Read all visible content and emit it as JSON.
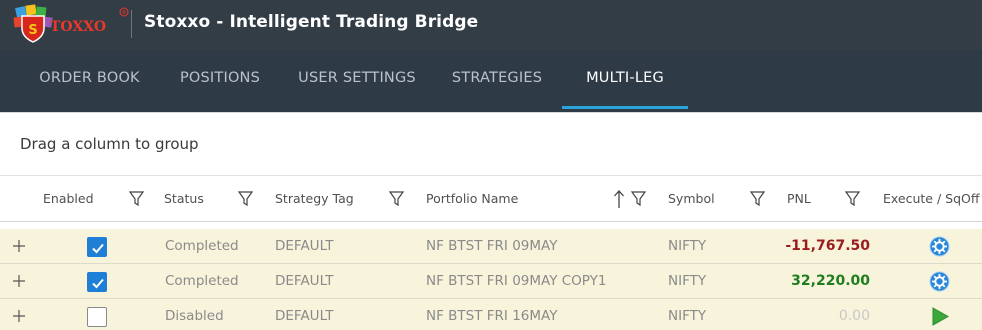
{
  "app": {
    "logo_text": "TOXXO",
    "title": "Stoxxo - Intelligent Trading Bridge"
  },
  "nav": {
    "tabs": [
      {
        "label": "ORDER BOOK",
        "active": false
      },
      {
        "label": "POSITIONS",
        "active": false
      },
      {
        "label": "USER SETTINGS",
        "active": false
      },
      {
        "label": "STRATEGIES",
        "active": false
      },
      {
        "label": "MULTI-LEG",
        "active": true
      }
    ],
    "accent": "#29a3d9"
  },
  "grid": {
    "group_panel_text": "Drag a column to group",
    "columns": {
      "enabled": "Enabled",
      "status": "Status",
      "strategy_tag": "Strategy Tag",
      "portfolio_name": "Portfolio Name",
      "symbol": "Symbol",
      "pnl": "PNL",
      "execute": "Execute / SqOff"
    },
    "sorted_column": "portfolio_name",
    "sort_direction": "ascending",
    "rows": [
      {
        "enabled": true,
        "status": "Completed",
        "strategy_tag": "DEFAULT",
        "portfolio_name": "NF BTST FRI 09MAY",
        "symbol": "NIFTY",
        "pnl": "-11,767.50",
        "pnl_color": "#9b1c1c",
        "action_icon": "sqoff-gear-icon"
      },
      {
        "enabled": true,
        "status": "Completed",
        "strategy_tag": "DEFAULT",
        "portfolio_name": "NF BTST FRI 09MAY COPY1",
        "symbol": "NIFTY",
        "pnl": "32,220.00",
        "pnl_color": "#1e7d1e",
        "action_icon": "sqoff-gear-icon"
      },
      {
        "enabled": false,
        "status": "Disabled",
        "strategy_tag": "DEFAULT",
        "portfolio_name": "NF BTST FRI 16MAY",
        "symbol": "NIFTY",
        "pnl": "0.00",
        "pnl_color": "#c8c8c8",
        "action_icon": "play-icon"
      }
    ]
  }
}
